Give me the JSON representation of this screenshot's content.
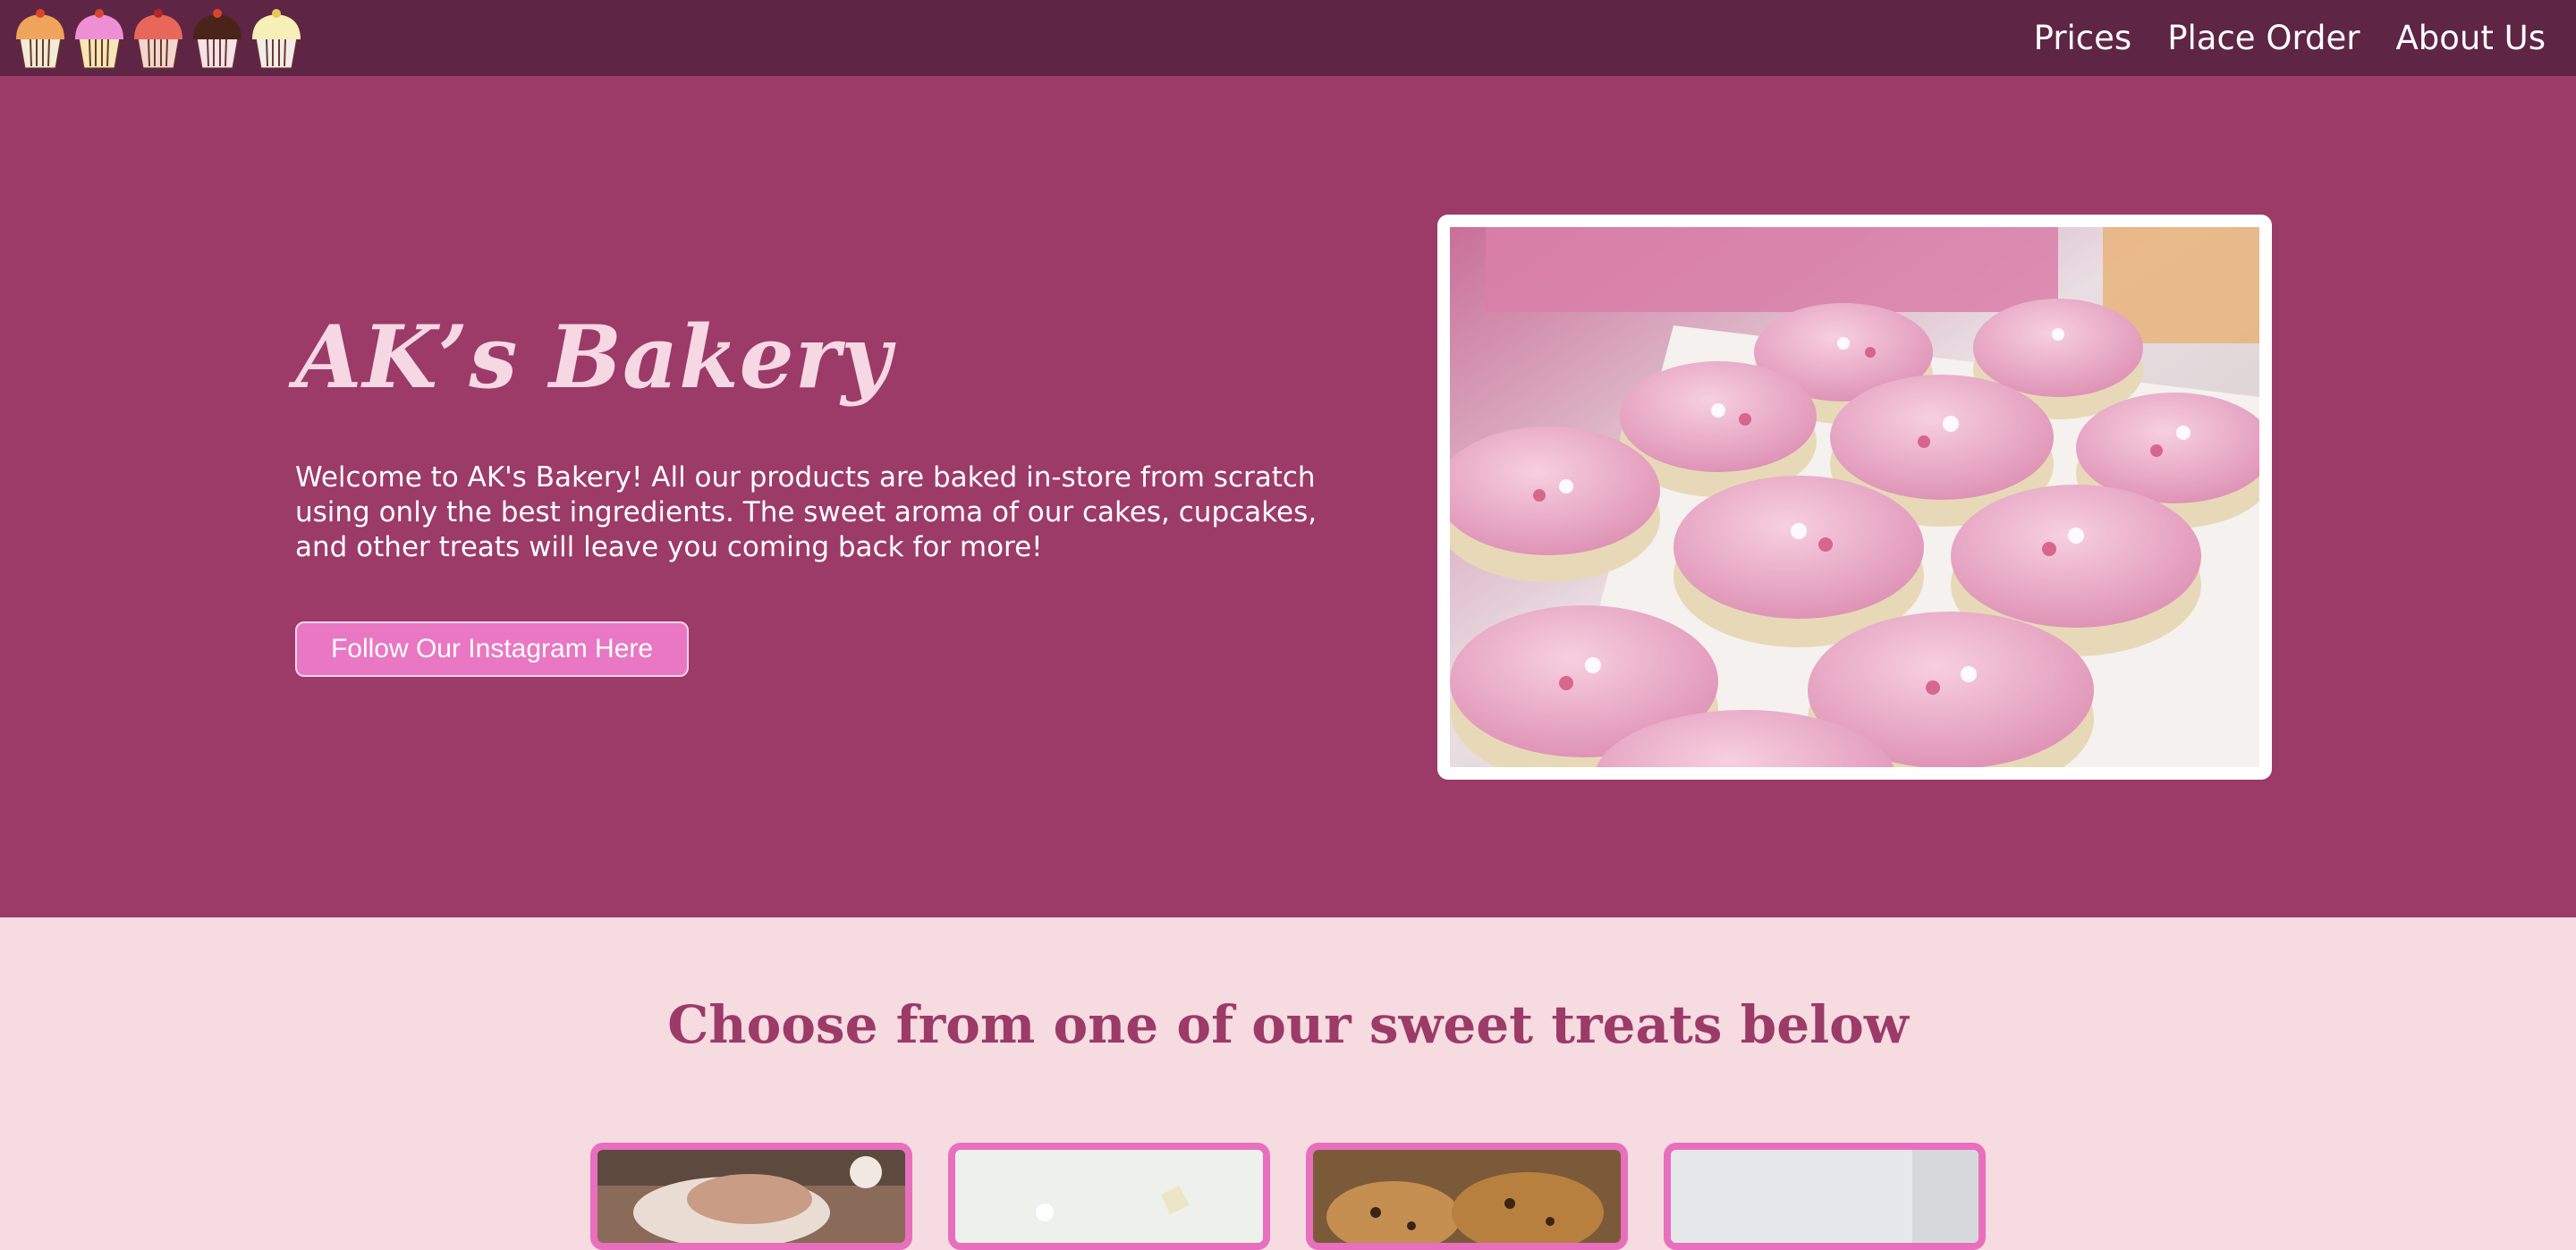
{
  "nav": {
    "logo_icons": [
      "cupcake-orange-icon",
      "cupcake-pink-icon",
      "cupcake-red-icon",
      "cupcake-chocolate-icon",
      "cupcake-vanilla-icon"
    ],
    "links": [
      "Prices",
      "Place Order",
      "About Us"
    ]
  },
  "hero": {
    "title": "AK’s Bakery",
    "description": "Welcome to AK's Bakery! All our products are baked in-store from scratch using only the best ingredients. The sweet aroma of our cakes, cupcakes, and other treats will leave you coming back for more!",
    "cta_label": "Follow Our Instagram Here",
    "image_icon": "pink-frosted-cupcakes-photo"
  },
  "treats": {
    "heading": "Choose from one of our sweet treats below",
    "cards": [
      "cake-photo",
      "white-cake-photo",
      "cookies-photo",
      "treat-photo"
    ]
  },
  "colors": {
    "navbar": "#5f2545",
    "hero_bg": "#9c3a68",
    "page_bg": "#f6dbe0",
    "accent_pink": "#e977c3",
    "title_pink": "#f6d8e4"
  }
}
